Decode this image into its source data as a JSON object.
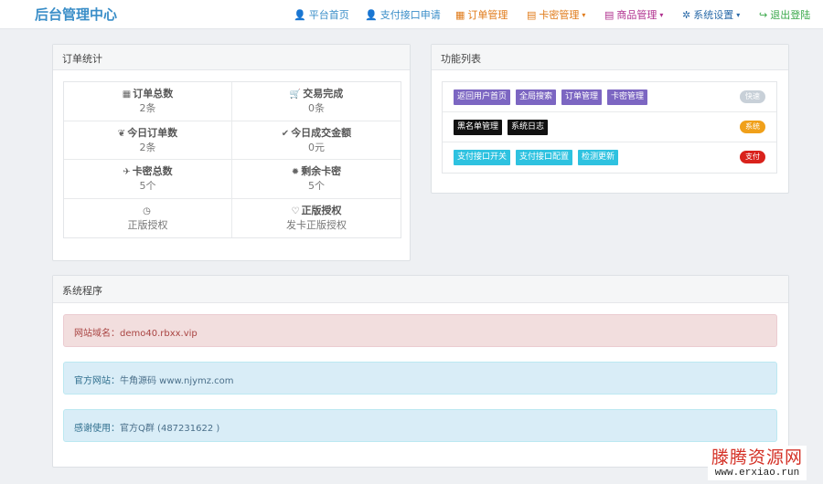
{
  "app": {
    "title": "后台管理中心"
  },
  "nav": [
    {
      "icon": "👤",
      "icon_name": "user-icon",
      "label": "平台首页",
      "color": "#3a8ec8",
      "caret": false
    },
    {
      "icon": "👤",
      "icon_name": "user-icon",
      "label": "支付接口申请",
      "color": "#3a8ec8",
      "caret": false
    },
    {
      "icon": "▦",
      "icon_name": "calendar-icon",
      "label": "订单管理",
      "color": "#e07b1a",
      "caret": false
    },
    {
      "icon": "▤",
      "icon_name": "list-icon",
      "label": "卡密管理",
      "color": "#e07b1a",
      "caret": true
    },
    {
      "icon": "▤",
      "icon_name": "list-icon",
      "label": "商品管理",
      "color": "#b0308e",
      "caret": true
    },
    {
      "icon": "✲",
      "icon_name": "gear-icon",
      "label": "系统设置",
      "color": "#2a6aa8",
      "caret": true
    },
    {
      "icon": "↪",
      "icon_name": "logout-icon",
      "label": "退出登陆",
      "color": "#3aa84a",
      "caret": false
    }
  ],
  "orders_panel": {
    "title": "订单统计",
    "stats": [
      {
        "icon": "▦",
        "icon_name": "grid-icon",
        "label": "订单总数",
        "value": "2条"
      },
      {
        "icon": "🛒",
        "icon_name": "cart-icon",
        "label": "交易完成",
        "value": "0条"
      },
      {
        "icon": "❦",
        "icon_name": "leaf-icon",
        "label": "今日订单数",
        "value": "2条"
      },
      {
        "icon": "✔",
        "icon_name": "check-icon",
        "label": "今日成交金额",
        "value": "0元"
      },
      {
        "icon": "✈",
        "icon_name": "plane-icon",
        "label": "卡密总数",
        "value": "5个"
      },
      {
        "icon": "✹",
        "icon_name": "asterisk-icon",
        "label": "剩余卡密",
        "value": "5个"
      },
      {
        "icon": "◷",
        "icon_name": "clock-icon",
        "label": "",
        "value": "正版授权"
      },
      {
        "icon": "♡",
        "icon_name": "heart-icon",
        "label": "正版授权",
        "value": "发卡正版授权"
      }
    ]
  },
  "func_panel": {
    "title": "功能列表",
    "rows": [
      {
        "buttons": [
          "返回用户首页",
          "全局搜索",
          "订单管理",
          "卡密管理"
        ],
        "style": "purple",
        "badge": "快速",
        "badge_color": "#c8d0d8"
      },
      {
        "buttons": [
          "黑名单管理",
          "系统日志"
        ],
        "style": "black",
        "badge": "系统",
        "badge_color": "#f0a01a"
      },
      {
        "buttons": [
          "支付接口开关",
          "支付接口配置",
          "检测更新"
        ],
        "style": "cyan",
        "badge": "支付",
        "badge_color": "#d9221c"
      }
    ]
  },
  "system_panel": {
    "title": "系统程序",
    "alerts": [
      {
        "label": "网站域名：",
        "value": "demo40.rbxx.vip",
        "type": "danger"
      },
      {
        "label": "官方网站：",
        "value": "牛角源码 www.njymz.com",
        "type": "info"
      },
      {
        "label": "感谢使用：",
        "value": "官方Q群 (487231622 )",
        "type": "info"
      }
    ]
  },
  "watermark": {
    "name": "滕腾资源网",
    "url": "www.erxiao.run"
  }
}
